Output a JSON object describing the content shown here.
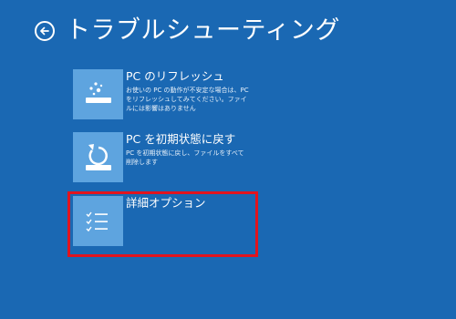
{
  "header": {
    "back_icon": "back-arrow-icon",
    "title": "トラブルシューティング"
  },
  "options": [
    {
      "icon": "refresh-pc-icon",
      "title": "PC のリフレッシュ",
      "description": "お使いの PC の動作が不安定な場合は、PC をリフレッシュしてみてください。ファイルには影響はありません"
    },
    {
      "icon": "reset-pc-icon",
      "title": "PC を初期状態に戻す",
      "description": "PC を初期状態に戻し、ファイルをすべて削除します"
    },
    {
      "icon": "advanced-options-icon",
      "title": "詳細オプション",
      "description": ""
    }
  ],
  "colors": {
    "background": "#1a68b3",
    "tile": "#5ea4df",
    "highlight": "#e1141e"
  }
}
